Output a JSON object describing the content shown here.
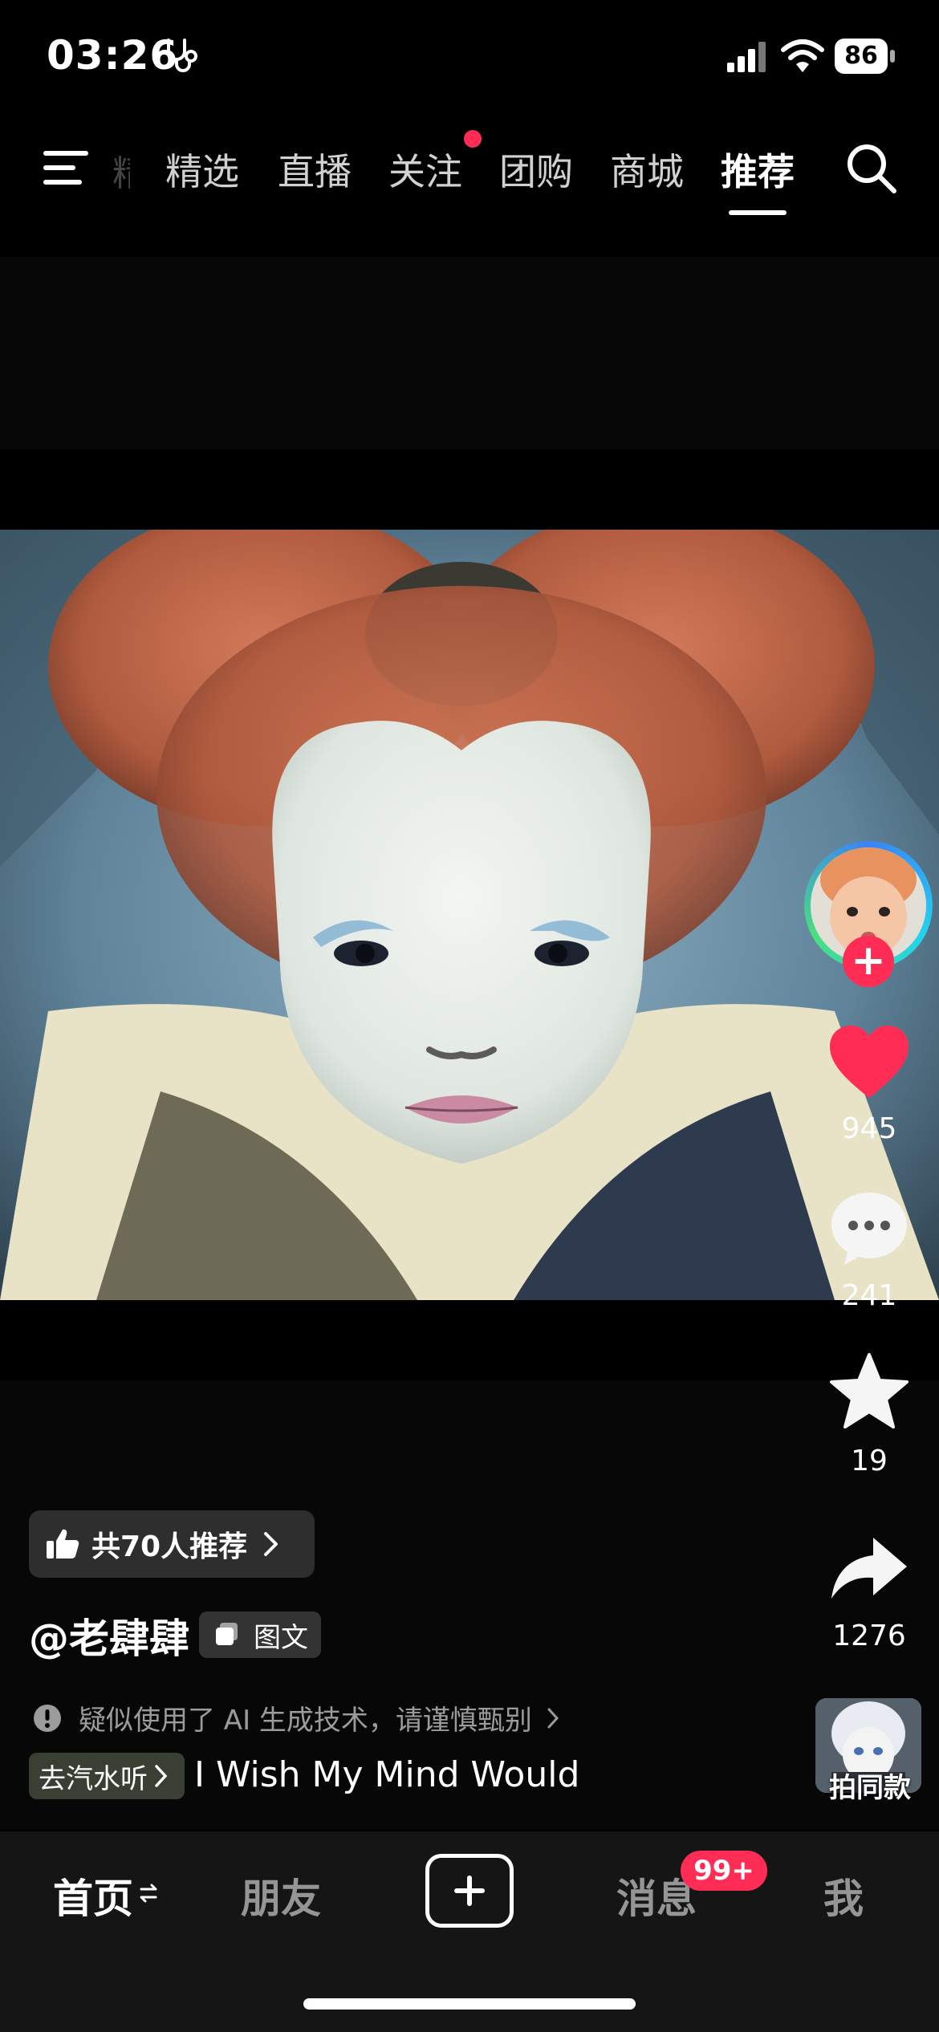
{
  "status_bar": {
    "time": "03:26",
    "battery": "86"
  },
  "top_nav": {
    "faded_tab": "精",
    "tabs": [
      {
        "label": "精选"
      },
      {
        "label": "直播"
      },
      {
        "label": "关注",
        "has_dot": true
      },
      {
        "label": "团购"
      },
      {
        "label": "商城"
      },
      {
        "label": "推荐",
        "active": true
      }
    ]
  },
  "right_rail": {
    "likes": "945",
    "comments": "241",
    "favorites": "19",
    "shares": "1276",
    "same_style_label": "拍同款"
  },
  "post": {
    "recommend_text": "共70人推荐",
    "author": "@老肆肆",
    "type_tag": "图文",
    "ai_warning": "疑似使用了 AI 生成技术，请谨慎甄别",
    "music_pill": "去汽水听",
    "song": "I Wish My Mind Would"
  },
  "bottom_nav": {
    "home": "首页",
    "friends": "朋友",
    "messages": "消息",
    "messages_badge": "99+",
    "me": "我"
  },
  "colors": {
    "accent": "#ff2d55",
    "background": "#000000",
    "tabbar": "#151515"
  }
}
